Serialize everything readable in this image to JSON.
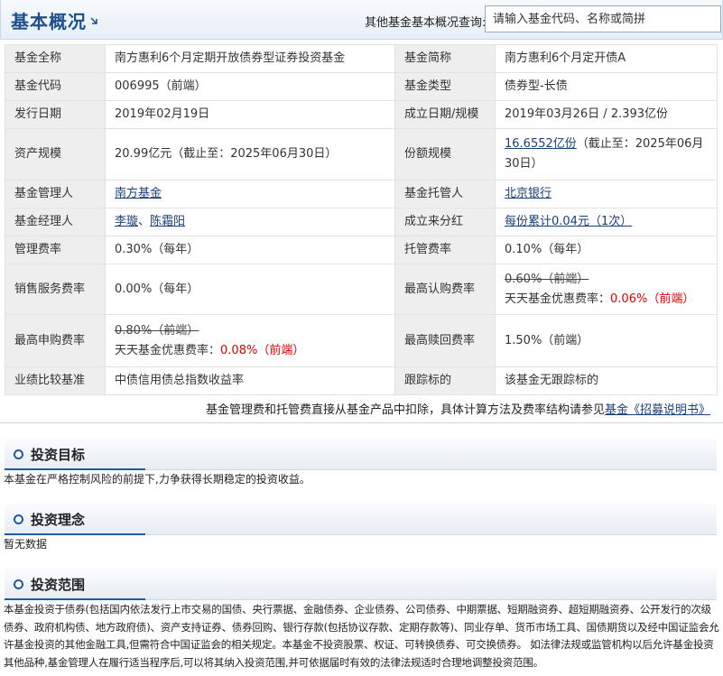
{
  "header": {
    "title": "基本概况",
    "search_label": "其他基金基本概况查询:",
    "search_placeholder": "请输入基金代码、名称或简拼"
  },
  "info": {
    "full_name_label": "基金全称",
    "full_name": "南方惠利6个月定期开放债券型证券投资基金",
    "short_name_label": "基金简称",
    "short_name": "南方惠利6个月定开债A",
    "code_label": "基金代码",
    "code": "006995（前端）",
    "type_label": "基金类型",
    "type": "债券型-长债",
    "issue_date_label": "发行日期",
    "issue_date": "2019年02月19日",
    "establish_label": "成立日期/规模",
    "establish": "2019年03月26日 / 2.393亿份",
    "asset_size_label": "资产规模",
    "asset_size": "20.99亿元（截止至：2025年06月30日）",
    "share_size_label": "份额规模",
    "share_size_link": "16.6552亿份",
    "share_size_rest": "（截止至：2025年06月30日）",
    "manager_label": "基金管理人",
    "manager": "南方基金",
    "custodian_label": "基金托管人",
    "custodian": "北京银行",
    "fund_manager_label": "基金经理人",
    "fund_manager_1": "李璇",
    "fund_manager_sep": "、",
    "fund_manager_2": "陈霜阳",
    "dividend_label": "成立来分红",
    "dividend": "每份累计0.04元（1次）",
    "mgmt_fee_label": "管理费率",
    "mgmt_fee": "0.30%（每年）",
    "custody_fee_label": "托管费率",
    "custody_fee": "0.10%（每年）",
    "sales_fee_label": "销售服务费率",
    "sales_fee": "0.00%（每年）",
    "max_sub_label": "最高认购费率",
    "max_sub_orig": "0.60%（前端）",
    "max_sub_discount_label": "天天基金优惠费率：",
    "max_sub_discount": "0.06%（前端）",
    "max_purchase_label": "最高申购费率",
    "max_purchase_orig": "0.80%（前端）",
    "max_purchase_discount_label": "天天基金优惠费率：",
    "max_purchase_discount": "0.08%（前端）",
    "max_redeem_label": "最高赎回费率",
    "max_redeem": "1.50%（前端）",
    "benchmark_label": "业绩比较基准",
    "benchmark": "中债信用债总指数收益率",
    "tracking_label": "跟踪标的",
    "tracking": "该基金无跟踪标的"
  },
  "footnote": {
    "text": "基金管理费和托管费直接从基金产品中扣除，具体计算方法及费率结构请参见",
    "link": "基金《招募说明书》"
  },
  "sections": {
    "objective_title": "投资目标",
    "objective_text": "本基金在严格控制风险的前提下,力争获得长期稳定的投资收益。",
    "philosophy_title": "投资理念",
    "philosophy_text": "暂无数据",
    "scope_title": "投资范围",
    "scope_text": "本基金投资于债券(包括国内依法发行上市交易的国债、央行票据、金融债券、企业债券、公司债券、中期票据、短期融资券、超短期融资券、公开发行的次级债券、政府机构债、地方政府债)、资产支持证券、债券回购、银行存款(包括协议存款、定期存款等)、同业存单、货币市场工具、国债期货以及经中国证监会允许基金投资的其他金融工具,但需符合中国证监会的相关规定。本基金不投资股票、权证、可转换债券、可交换债券。 如法律法规或监管机构以后允许基金投资其他品种,基金管理人在履行适当程序后,可以将其纳入投资范围,并可依据届时有效的法律法规适时合理地调整投资范围。"
  }
}
